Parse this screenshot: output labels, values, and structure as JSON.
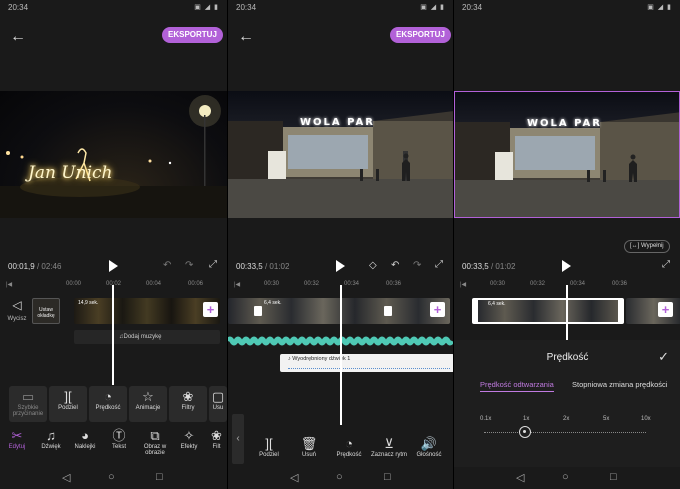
{
  "panels": [
    {
      "status_time": "20:34",
      "export_label": "EKSPORTUJ",
      "sign_text": "Jan Unich",
      "time_current": "00:01,9",
      "time_total": "/ 02:46",
      "ruler_ticks": [
        "00:00",
        "00:02",
        "00:04",
        "00:06"
      ],
      "mute_label": "Wycisz",
      "cover_label": "Ustaw okładkę",
      "clip_duration": "14,9 sek.",
      "add_music_label": "Dodaj muzykę",
      "edit_tools": [
        {
          "label": "Szybkie przycinanie",
          "icon": "trim-icon"
        },
        {
          "label": "Podziel",
          "icon": "split-icon"
        },
        {
          "label": "Prędkość",
          "icon": "speed-icon"
        },
        {
          "label": "Animacje",
          "icon": "animation-icon"
        },
        {
          "label": "Filtry",
          "icon": "filter-icon"
        },
        {
          "label": "Usu",
          "icon": "delete-icon"
        }
      ],
      "main_tabs": [
        {
          "label": "Edytuj",
          "icon": "scissors-icon",
          "active": true
        },
        {
          "label": "Dźwięk",
          "icon": "music-icon"
        },
        {
          "label": "Naklejki",
          "icon": "sticker-icon"
        },
        {
          "label": "Tekst",
          "icon": "text-icon"
        },
        {
          "label": "Obraz w obrazie",
          "icon": "pip-icon"
        },
        {
          "label": "Efekty",
          "icon": "effects-icon"
        },
        {
          "label": "Filt",
          "icon": "filter-icon"
        }
      ]
    },
    {
      "status_time": "20:34",
      "export_label": "EKSPORTUJ",
      "sign_text": "WOLA PAR",
      "time_current": "00:33,5",
      "time_total": "/ 01:02",
      "ruler_ticks": [
        "00:30",
        "00:32",
        "00:34",
        "00:36"
      ],
      "clip_duration": "6,4 sek.",
      "extracted_audio_label": "Wyodrębniony dźwięk 1",
      "audio_tools": [
        {
          "label": "Podziel",
          "icon": "split-icon"
        },
        {
          "label": "Usuń",
          "icon": "trash-icon"
        },
        {
          "label": "Prędkość",
          "icon": "speed-icon"
        },
        {
          "label": "Zaznacz rytm",
          "icon": "beat-icon"
        },
        {
          "label": "Głośność",
          "icon": "volume-icon"
        }
      ]
    },
    {
      "status_time": "20:34",
      "sign_text": "WOLA PAR",
      "fill_label": "Wypełnij",
      "time_current": "00:33,5",
      "time_total": "/ 01:02",
      "ruler_ticks": [
        "00:30",
        "00:32",
        "00:34",
        "00:36"
      ],
      "clip_duration": "6,4 sek.",
      "speed_title": "Prędkość",
      "speed_tabs": [
        "Prędkość odtwarzania",
        "Stopniowa zmiana prędkości"
      ],
      "speed_marks": [
        "0.1x",
        "1x",
        "2x",
        "5x",
        "10x"
      ],
      "speed_selected": "1x"
    }
  ],
  "colors": {
    "accent": "#b261d8",
    "waveform": "#4fc9b5",
    "background": "#1a1a1a"
  }
}
